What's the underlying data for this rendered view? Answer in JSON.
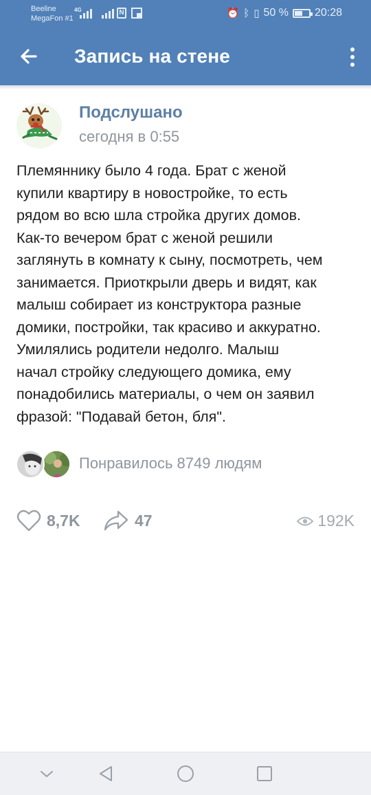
{
  "status_bar": {
    "carrier_1": "Beeline",
    "carrier_2": "MegaFon #1",
    "network_tag": "4G",
    "nfc_label": "N",
    "battery_percent": "50 %",
    "time": "20:28"
  },
  "app_bar": {
    "title": "Запись на стене",
    "back_icon": "arrow-left-icon",
    "menu_icon": "more-vertical-icon",
    "background_color": "#5181b8"
  },
  "post": {
    "author": "Подслушано",
    "date": "сегодня в 0:55",
    "text_lines": [
      "Племяннику было 4 года. Брат с женой",
      "купили квартиру в новостройке, то есть",
      "рядом во всю шла стройка других домов.",
      "Как-то вечером брат с женой решили",
      "заглянуть в комнату к сыну, посмотреть, чем",
      "занимается. Приоткрыли дверь и видят, как",
      "малыш собирает из конструктора разные",
      "домики, постройки, так красиво и аккуратно.",
      "Умилялись родители недолго. Малыш",
      "начал стройку следующего домика, ему",
      "понадобились материалы, о чем он заявил",
      "фразой: \"Подавай бетон, бля\"."
    ],
    "liked_by": "Понравилось 8749 людям"
  },
  "actions": {
    "likes": "8,7K",
    "shares": "47",
    "views": "192K"
  },
  "nav_bar": {
    "items": [
      "chevron-down-icon",
      "back-triangle-icon",
      "home-circle-icon",
      "recents-square-icon"
    ]
  }
}
